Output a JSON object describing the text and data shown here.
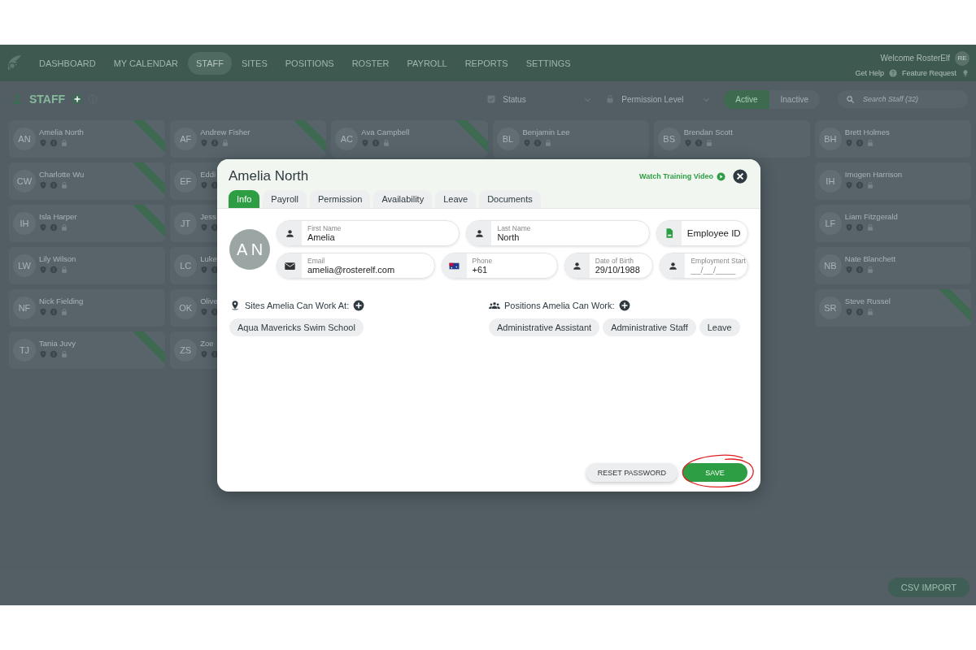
{
  "nav": {
    "items": [
      {
        "label": "DASHBOARD",
        "selected": false
      },
      {
        "label": "MY CALENDAR",
        "selected": false
      },
      {
        "label": "STAFF",
        "selected": true
      },
      {
        "label": "SITES",
        "selected": false
      },
      {
        "label": "POSITIONS",
        "selected": false
      },
      {
        "label": "ROSTER",
        "selected": false
      },
      {
        "label": "PAYROLL",
        "selected": false
      },
      {
        "label": "REPORTS",
        "selected": false
      },
      {
        "label": "SETTINGS",
        "selected": false
      }
    ],
    "welcome": "Welcome RosterElf",
    "user_initials": "RE",
    "help": "Get Help",
    "feature_request": "Feature Request"
  },
  "staff_header": {
    "title": "STAFF",
    "status_filter": "Status",
    "permission_filter": "Permission Level",
    "toggle": [
      {
        "label": "Active",
        "selected": true
      },
      {
        "label": "Inactive",
        "selected": false
      }
    ],
    "search": {
      "placeholder": "Search Staff (32)"
    }
  },
  "staff_columns": [
    [
      {
        "initials": "AN",
        "name": "Amelia North",
        "ribbon": true
      },
      {
        "initials": "CW",
        "name": "Charlotte Wu",
        "ribbon": true
      },
      {
        "initials": "IH",
        "name": "Isla Harper",
        "ribbon": true
      },
      {
        "initials": "LW",
        "name": "Lily Wilson",
        "ribbon": false
      },
      {
        "initials": "NF",
        "name": "Nick Fielding",
        "ribbon": false
      },
      {
        "initials": "TJ",
        "name": "Tania Juvy",
        "ribbon": true
      }
    ],
    [
      {
        "initials": "AF",
        "name": "Andrew Fisher",
        "ribbon": true
      },
      {
        "initials": "EF",
        "name": "Eddi",
        "ribbon": false
      },
      {
        "initials": "JT",
        "name": "Jess",
        "ribbon": false
      },
      {
        "initials": "LC",
        "name": "Luke",
        "ribbon": false
      },
      {
        "initials": "OK",
        "name": "Olive",
        "ribbon": false
      },
      {
        "initials": "ZS",
        "name": "Zoe",
        "ribbon": false
      }
    ],
    [
      {
        "initials": "AC",
        "name": "Ava Campbell",
        "ribbon": true
      }
    ],
    [
      {
        "initials": "BL",
        "name": "Benjamin Lee",
        "ribbon": false
      }
    ],
    [
      {
        "initials": "BS",
        "name": "Brendan Scott",
        "ribbon": false
      }
    ],
    [
      {
        "initials": "BH",
        "name": "Brett Holmes",
        "ribbon": false
      },
      {
        "initials": "IH",
        "name": "Imogen Harrison",
        "ribbon": false
      },
      {
        "initials": "LF",
        "name": "Liam Fitzgerald",
        "ribbon": false
      },
      {
        "initials": "NB",
        "name": "Nate Blanchett",
        "ribbon": false
      },
      {
        "initials": "SR",
        "name": "Steve Russel",
        "ribbon": true
      }
    ]
  ],
  "csv_import": "CSV IMPORT",
  "modal": {
    "title": "Amelia North",
    "training_link": "Watch Training Video",
    "tabs": [
      {
        "label": "Info",
        "selected": true
      },
      {
        "label": "Payroll",
        "selected": false
      },
      {
        "label": "Permission",
        "selected": false
      },
      {
        "label": "Availability",
        "selected": false
      },
      {
        "label": "Leave",
        "selected": false
      },
      {
        "label": "Documents",
        "selected": false
      }
    ],
    "avatar_initials": "A N",
    "field_rows": [
      [
        {
          "kind": "person",
          "label": "First Name",
          "value": "Amelia"
        },
        {
          "kind": "person",
          "label": "Last Name",
          "value": "North"
        },
        {
          "kind": "id",
          "placeholder": "Employee ID"
        }
      ],
      [
        {
          "kind": "email",
          "label": "Email",
          "value": "amelia@rosterelf.com"
        },
        {
          "kind": "phone",
          "label": "Phone",
          "value": "+61"
        },
        {
          "kind": "person",
          "label": "Date of Birth",
          "value": "29/10/1988"
        },
        {
          "kind": "person",
          "label": "Employment Start",
          "placeholder": "__/__/____"
        }
      ]
    ],
    "sites": {
      "heading": "Sites Amelia Can Work At:",
      "chips": [
        "Aqua Mavericks Swim School"
      ]
    },
    "positions": {
      "heading": "Positions Amelia Can Work:",
      "chips": [
        "Administrative Assistant",
        "Administrative Staff",
        "Leave"
      ]
    },
    "buttons": [
      {
        "kind": "secondary",
        "label": "RESET PASSWORD",
        "annotated": false
      },
      {
        "kind": "primary",
        "label": "SAVE",
        "annotated": true
      }
    ]
  }
}
